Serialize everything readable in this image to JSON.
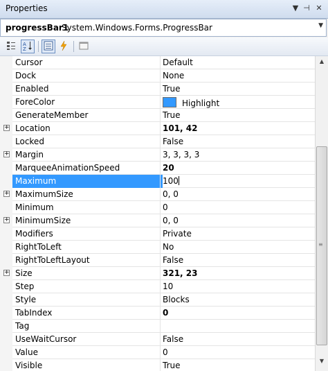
{
  "window": {
    "title": "Properties"
  },
  "object_selector": {
    "name": "progressBar1",
    "type": "System.Windows.Forms.ProgressBar"
  },
  "toolbar": {
    "buttons": [
      {
        "icon": "categorized-icon"
      },
      {
        "icon": "alphabetical-icon",
        "active": true
      },
      {
        "icon": "properties-icon",
        "active": true
      },
      {
        "icon": "events-icon"
      },
      {
        "icon": "property-pages-icon"
      }
    ]
  },
  "properties": [
    {
      "name": "Cursor",
      "value": "Default"
    },
    {
      "name": "Dock",
      "value": "None"
    },
    {
      "name": "Enabled",
      "value": "True"
    },
    {
      "name": "ForeColor",
      "value": "Highlight",
      "swatch": "#3399ff"
    },
    {
      "name": "GenerateMember",
      "value": "True"
    },
    {
      "name": "Location",
      "value": "101, 42",
      "bold": true,
      "expandable": true
    },
    {
      "name": "Locked",
      "value": "False"
    },
    {
      "name": "Margin",
      "value": "3, 3, 3, 3",
      "expandable": true
    },
    {
      "name": "MarqueeAnimationSpeed",
      "value": "20",
      "bold": true
    },
    {
      "name": "Maximum",
      "value": "100",
      "selected": true
    },
    {
      "name": "MaximumSize",
      "value": "0, 0",
      "expandable": true
    },
    {
      "name": "Minimum",
      "value": "0"
    },
    {
      "name": "MinimumSize",
      "value": "0, 0",
      "expandable": true
    },
    {
      "name": "Modifiers",
      "value": "Private"
    },
    {
      "name": "RightToLeft",
      "value": "No"
    },
    {
      "name": "RightToLeftLayout",
      "value": "False"
    },
    {
      "name": "Size",
      "value": "321, 23",
      "bold": true,
      "expandable": true
    },
    {
      "name": "Step",
      "value": "10"
    },
    {
      "name": "Style",
      "value": "Blocks"
    },
    {
      "name": "TabIndex",
      "value": "0",
      "bold": true
    },
    {
      "name": "Tag",
      "value": ""
    },
    {
      "name": "UseWaitCursor",
      "value": "False"
    },
    {
      "name": "Value",
      "value": "0"
    },
    {
      "name": "Visible",
      "value": "True"
    }
  ]
}
